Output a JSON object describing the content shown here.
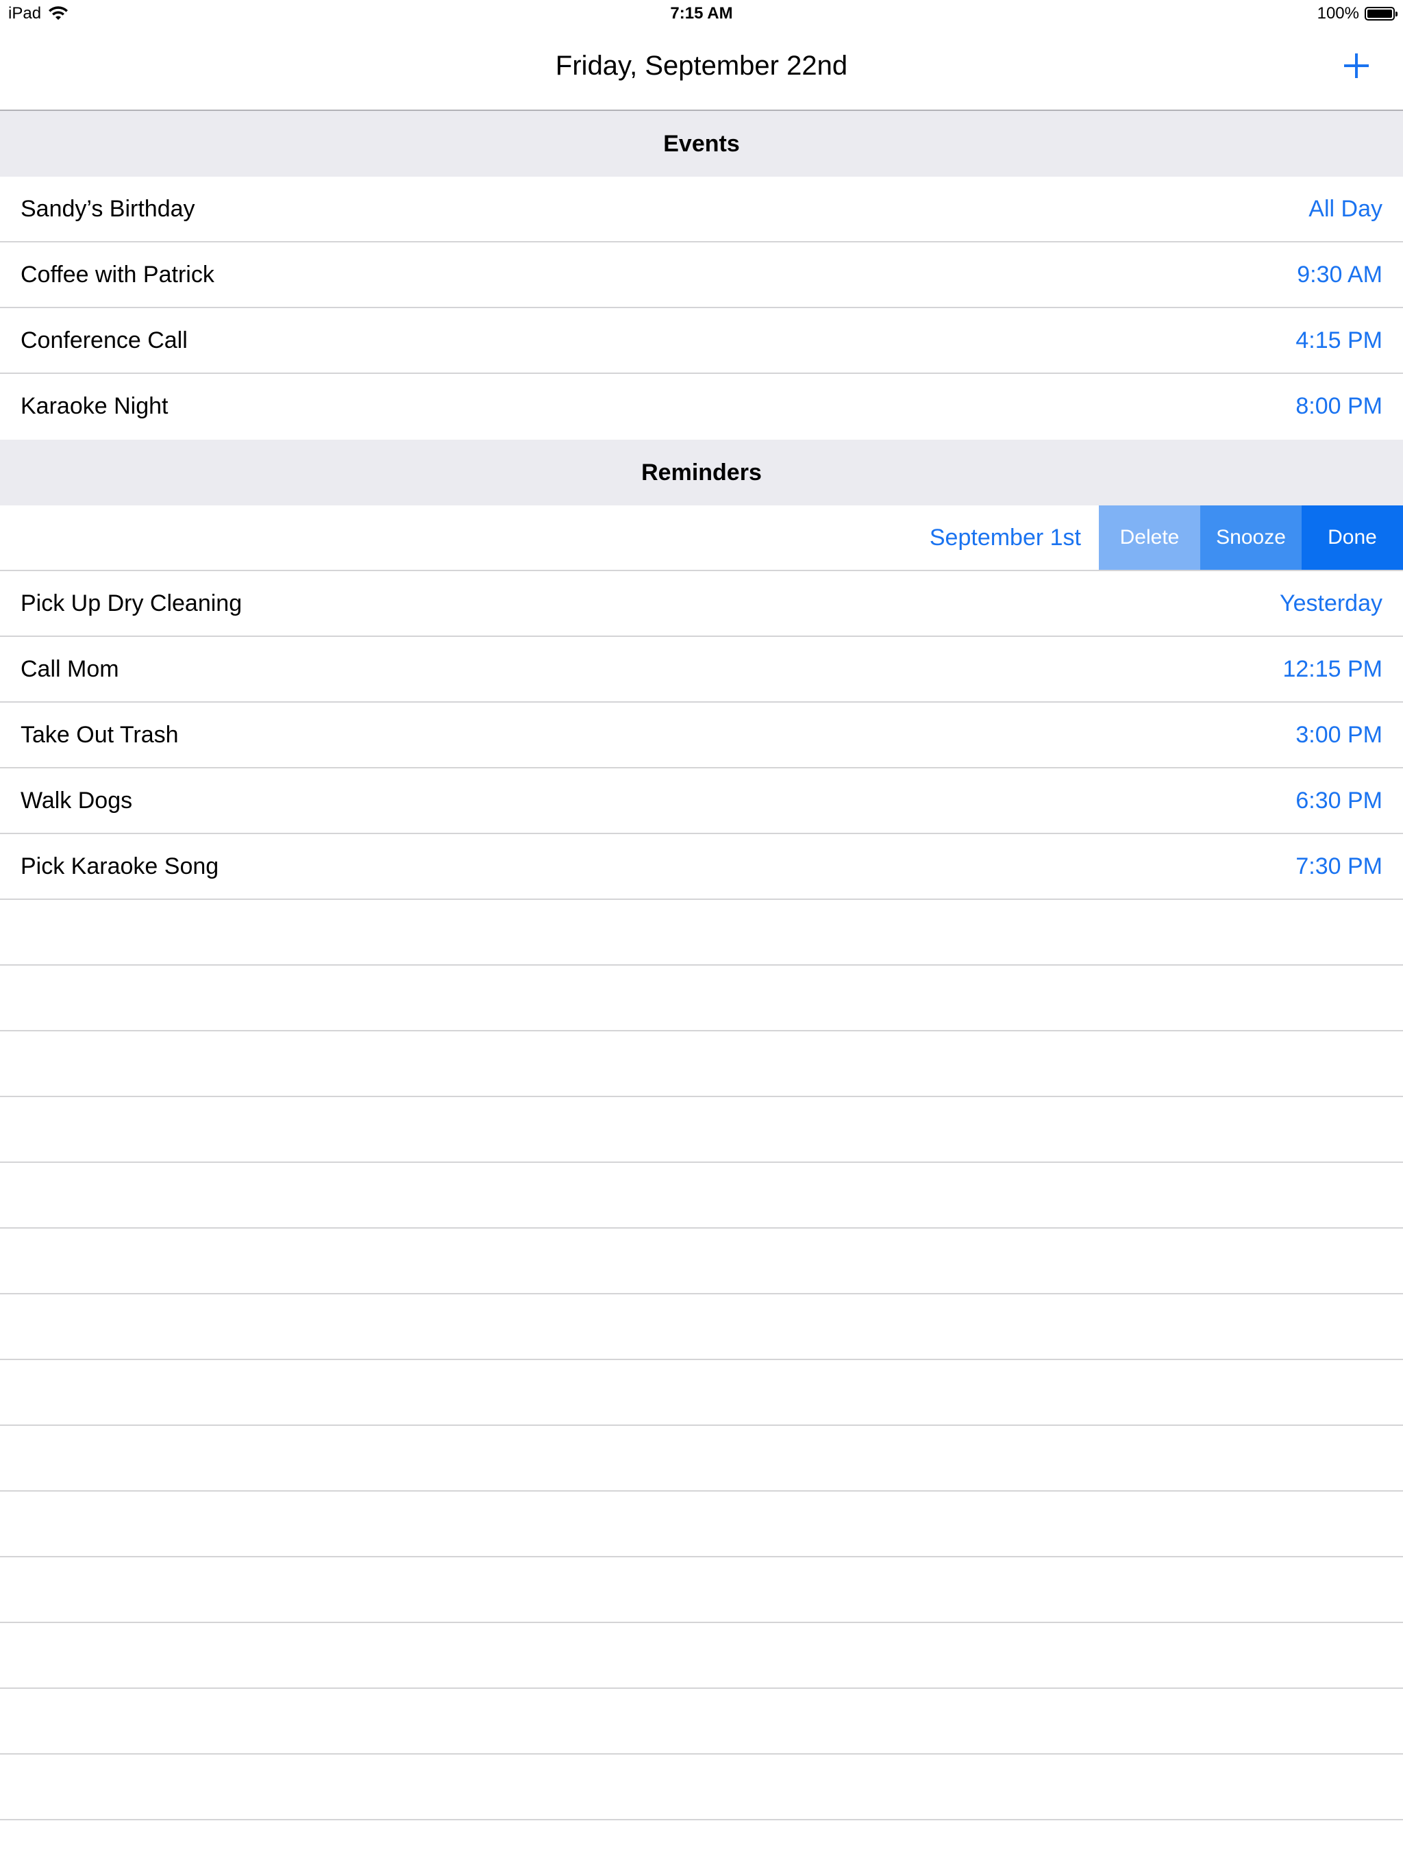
{
  "status_bar": {
    "device": "iPad",
    "time": "7:15 AM",
    "battery": "100%",
    "battery_level": 1.0
  },
  "nav": {
    "title": "Friday, September 22nd",
    "add_icon": "plus-icon"
  },
  "events": {
    "header": "Events",
    "items": [
      {
        "title": "Sandy’s Birthday",
        "detail": "All Day"
      },
      {
        "title": "Coffee with Patrick",
        "detail": "9:30 AM"
      },
      {
        "title": "Conference Call",
        "detail": "4:15 PM"
      },
      {
        "title": "Karaoke Night",
        "detail": "8:00 PM"
      }
    ]
  },
  "reminders": {
    "header": "Reminders",
    "swiped_item": {
      "detail": "September 1st",
      "actions": {
        "delete": "Delete",
        "snooze": "Snooze",
        "done": "Done"
      }
    },
    "items": [
      {
        "title": "Pick Up Dry Cleaning",
        "detail": "Yesterday"
      },
      {
        "title": "Call Mom",
        "detail": "12:15 PM"
      },
      {
        "title": "Take Out Trash",
        "detail": "3:00 PM"
      },
      {
        "title": "Walk Dogs",
        "detail": "6:30 PM"
      },
      {
        "title": "Pick Karaoke Song",
        "detail": "7:30 PM"
      }
    ]
  },
  "colors": {
    "accent": "#1a73f0",
    "section_bg": "#ebebf0",
    "delete_bg": "#7fb2f5",
    "snooze_bg": "#3e8ff2",
    "done_bg": "#0a6ff0"
  }
}
